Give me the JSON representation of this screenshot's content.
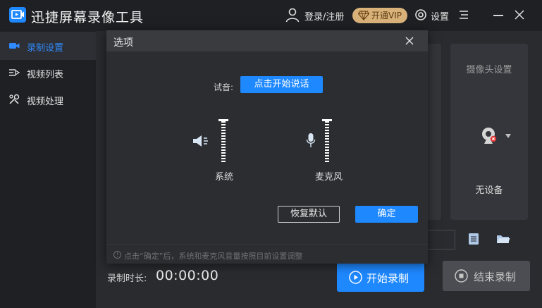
{
  "app": {
    "title": "迅捷屏幕录像工具"
  },
  "header": {
    "login_label": "登录/注册",
    "vip_label": "开通VIP",
    "settings_label": "设置"
  },
  "sidebar": {
    "items": [
      {
        "label": "录制设置",
        "icon": "camera-icon",
        "active": true
      },
      {
        "label": "视频列表",
        "icon": "video-list-icon",
        "active": false
      },
      {
        "label": "视频处理",
        "icon": "tools-icon",
        "active": false
      }
    ]
  },
  "camera": {
    "title": "摄像头设置",
    "status": "无设备"
  },
  "recording": {
    "duration_label": "录制时长:",
    "duration_value": "00:00:00",
    "start_label": "开始录制",
    "stop_label": "结束录制"
  },
  "dialog": {
    "title": "选项",
    "try_label": "试音:",
    "try_button": "点击开始说话",
    "system_label": "系统",
    "mic_label": "麦克风",
    "reset_button": "恢复默认",
    "ok_button": "确定",
    "footer_note": "点击“确定”后，系统和麦克风音量按照目前设置调整"
  },
  "colors": {
    "accent": "#1e88ff",
    "vip": "#d9b27a",
    "background": "#2a2b2f",
    "sidebar": "#1f2024"
  }
}
